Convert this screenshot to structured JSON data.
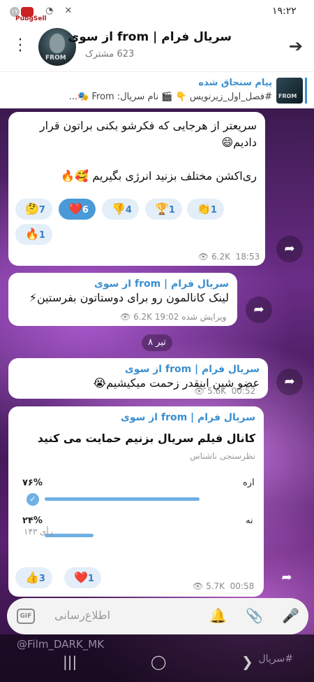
{
  "status": {
    "time": "۱۹:۲۲",
    "badge": "۱۷",
    "logo_text": "PubgSell"
  },
  "header": {
    "title": "سریال فرام | from از سوی",
    "subscribers": "623 مشترک",
    "avatar_text": "FROM"
  },
  "pinned": {
    "title": "پیام سنجاق شده",
    "text": "#فصل_اول_زیرنویس 👇 🎬 نام سریال: From 🎭...",
    "thumb_text": "FROM"
  },
  "messages": [
    {
      "text_line1": "سریعتر از هرجایی که فکرشو بکنی براتون قرار",
      "text_line2": "دادیم😄",
      "text_line3": "ری‌اکشن مختلف بزنید انرژی بگیریم 🥰🔥",
      "views": "6.2K",
      "time": "18:53",
      "reactions": [
        {
          "emoji": "👏",
          "count": "1"
        },
        {
          "emoji": "🏆",
          "count": "1"
        },
        {
          "emoji": "👎",
          "count": "4"
        },
        {
          "emoji": "❤️",
          "count": "6"
        },
        {
          "emoji": "🤔",
          "count": "7"
        },
        {
          "emoji": "🔥",
          "count": "1"
        }
      ]
    },
    {
      "sender": "سریال فرام | from از سوی",
      "text": "لینک کانالمون رو برای دوستاتون بفرستین⚡",
      "edited": "ویرایش شده",
      "views": "6.2K",
      "time": "19:02"
    },
    {
      "sender": "سریال فرام | from از سوی",
      "text": "عضو شین اینقدر زحمت میکیشیم😭",
      "views": "5.6K",
      "time": "00:52"
    },
    {
      "sender": "سریال فرام | from از سوی",
      "poll_question": "کانال فیلم سریال بزنیم حمایت می کنید",
      "poll_type": "نظرسنجی ناشناس",
      "options": [
        {
          "label": "اره",
          "percent": "۷۶%",
          "fraction": 0.76
        },
        {
          "label": "نه",
          "percent": "۲۴%",
          "fraction": 0.24
        }
      ],
      "votes": "۱۴۳ رأی",
      "views": "5.7K",
      "time": "00:58",
      "reactions": [
        {
          "emoji": "👍",
          "count": "3"
        },
        {
          "emoji": "❤️",
          "count": "1"
        }
      ]
    }
  ],
  "date_chip": "۸ تیر",
  "input": {
    "placeholder": "اطلاع‌رسانی",
    "gif_label": "GIF"
  },
  "footer": {
    "handle": "@Film_DARK_MK",
    "tag": "#سریال"
  },
  "colors": {
    "accent": "#3a8fd0",
    "reaction_active": "#4a9ad8",
    "poll_bar": "#6fb0e6"
  }
}
